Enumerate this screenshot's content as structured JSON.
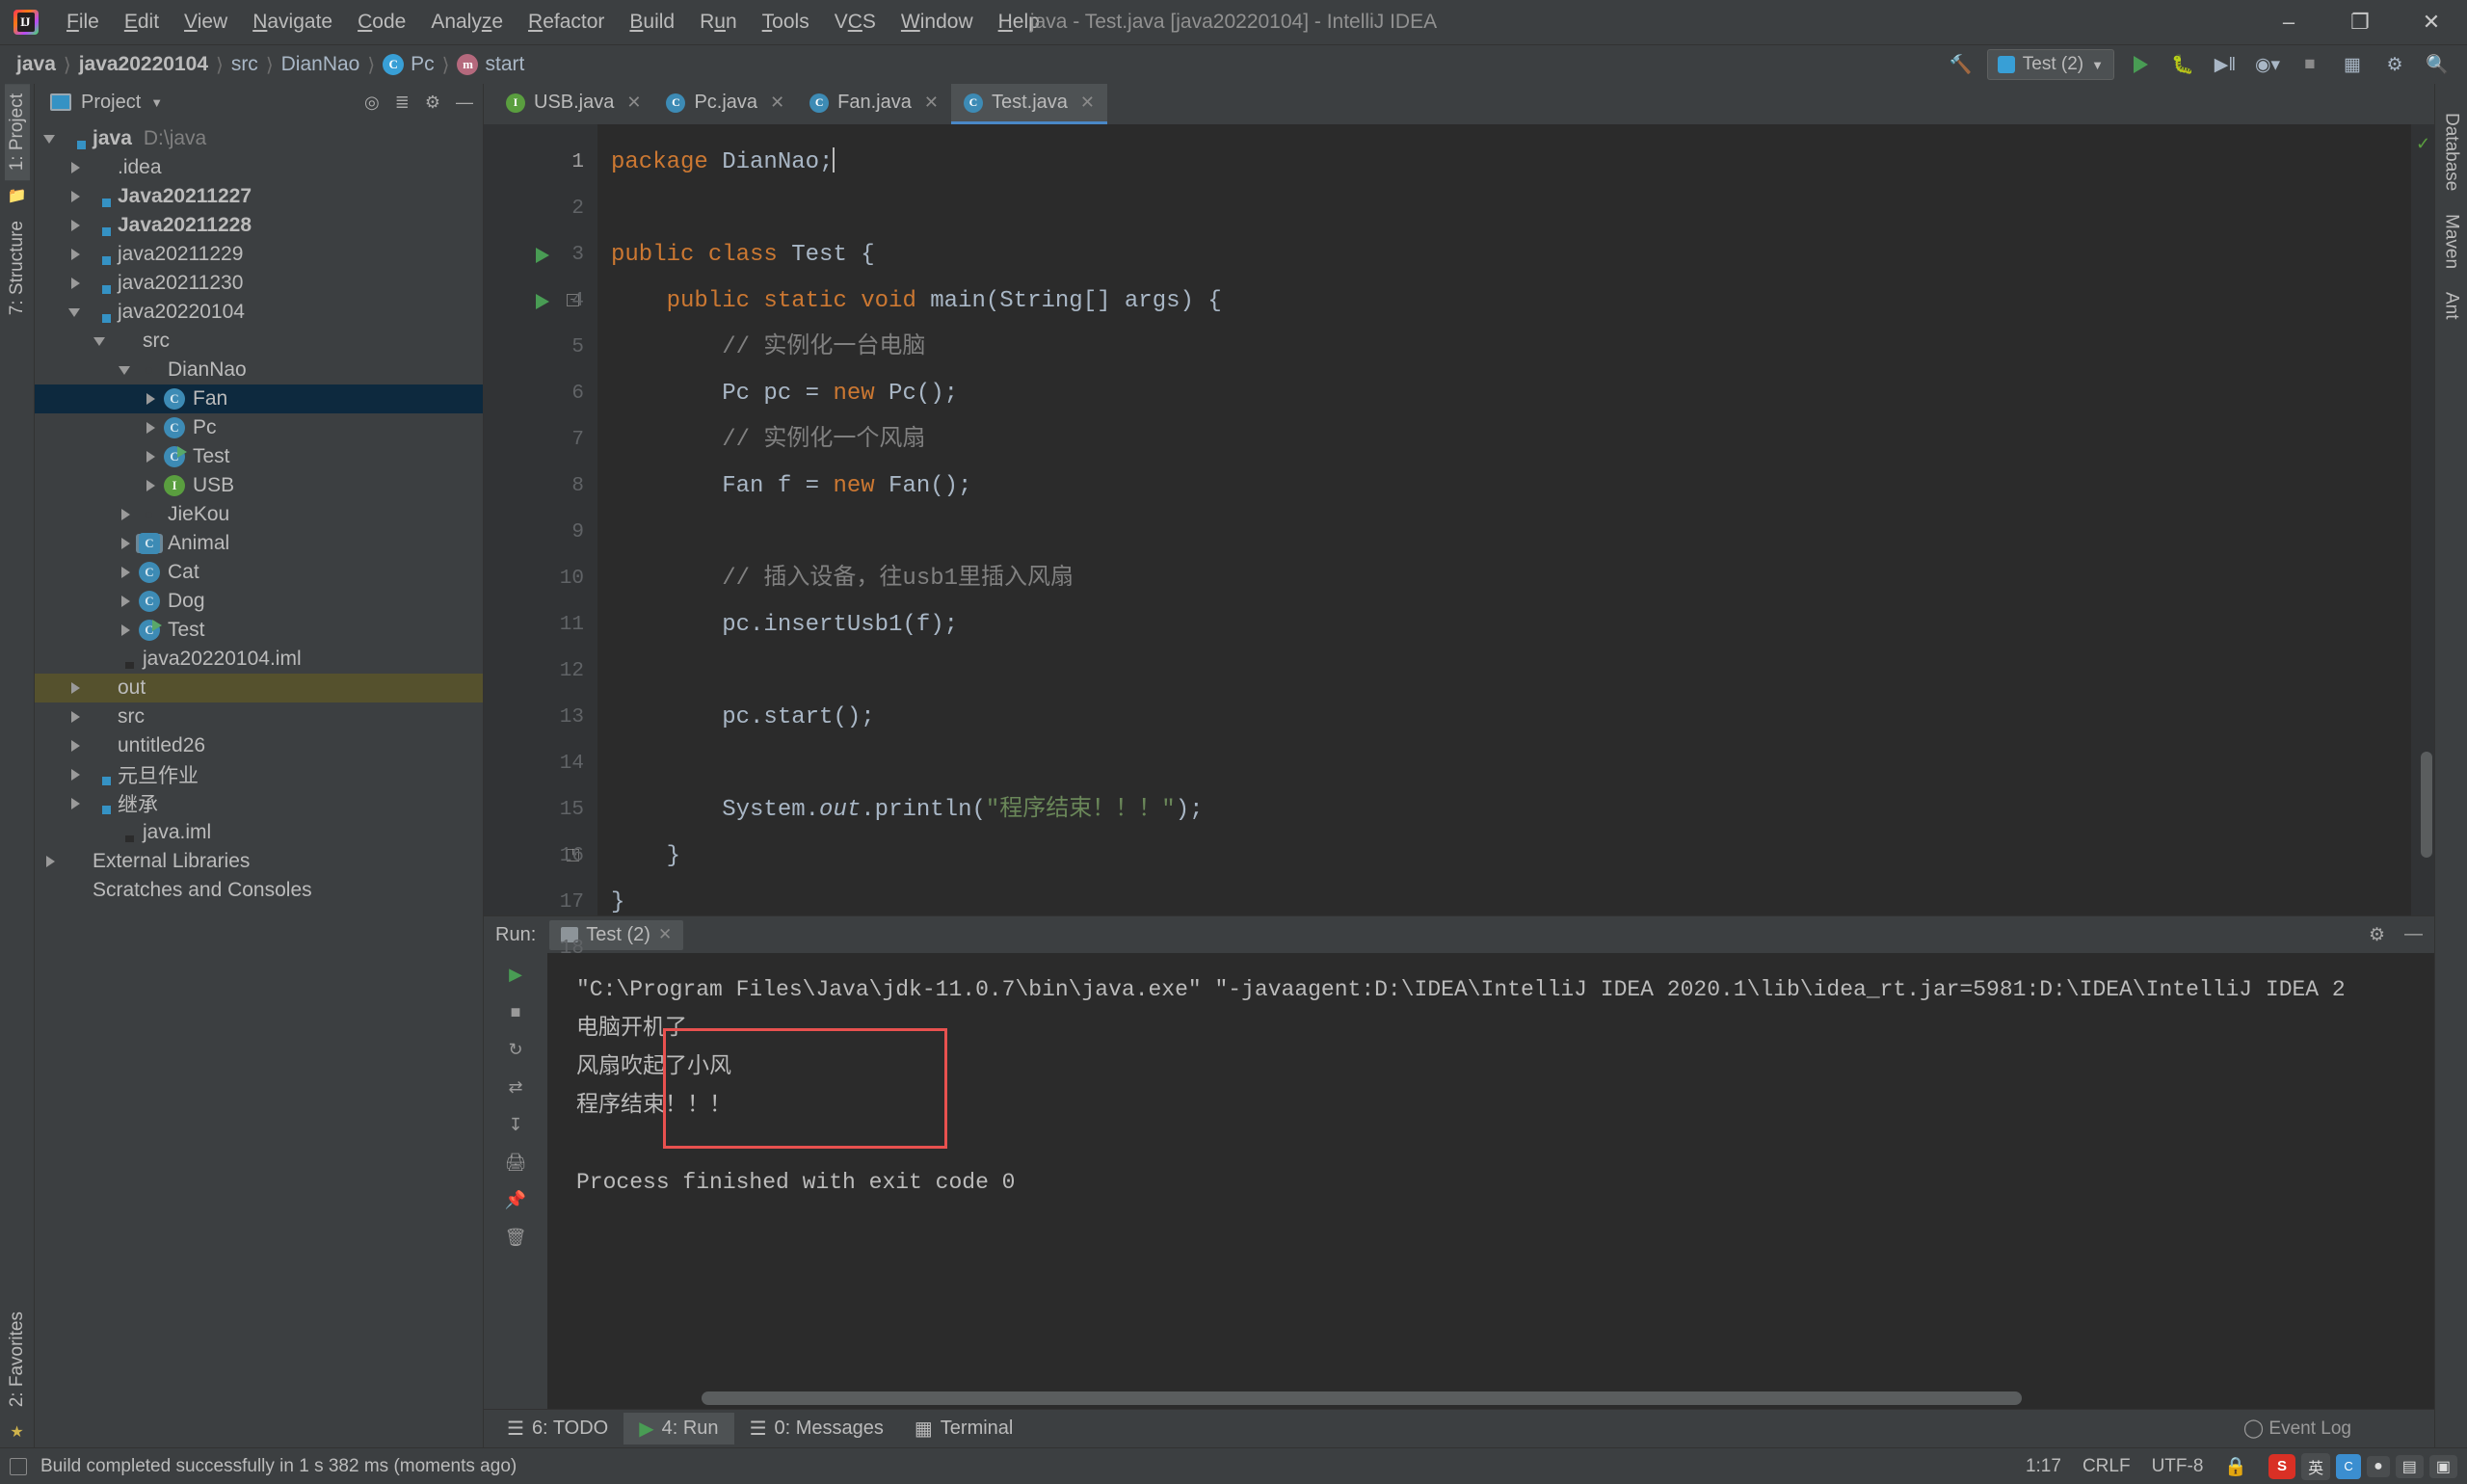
{
  "window": {
    "title": "java - Test.java [java20220104] - IntelliJ IDEA",
    "minimize": "–",
    "maximize": "❐",
    "close": "✕"
  },
  "menu": [
    {
      "label": "File"
    },
    {
      "label": "Edit"
    },
    {
      "label": "View"
    },
    {
      "label": "Navigate"
    },
    {
      "label": "Code"
    },
    {
      "label": "Analyze"
    },
    {
      "label": "Refactor"
    },
    {
      "label": "Build"
    },
    {
      "label": "Run"
    },
    {
      "label": "Tools"
    },
    {
      "label": "VCS"
    },
    {
      "label": "Window"
    },
    {
      "label": "Help"
    }
  ],
  "breadcrumb": [
    {
      "label": "java",
      "bold": true
    },
    {
      "label": "java20220104",
      "bold": true
    },
    {
      "label": "src",
      "bold": false
    },
    {
      "label": "DianNao",
      "bold": false
    },
    {
      "label": "Pc",
      "icon": "class-icon"
    },
    {
      "label": "start",
      "icon": "method-icon"
    }
  ],
  "toolbar": {
    "run_config": "Test (2)",
    "run_label": "Run",
    "debug_label": "Debug",
    "coverage_label": "Run with Coverage",
    "profile_label": "Profiler",
    "stop_label": "Stop",
    "search_label": "Search Everywhere",
    "build_label": "Build Project"
  },
  "project_panel": {
    "title": "Project",
    "settings_icon": "gear-icon",
    "collapse_icon": "collapse-all-icon",
    "locate_icon": "select-opened-file-icon",
    "hide_icon": "hide-icon",
    "tree": [
      {
        "label": "java",
        "detail": "D:\\java",
        "depth": 0,
        "arrow": "down",
        "icon": "module-folder",
        "bold": true
      },
      {
        "label": ".idea",
        "detail": "",
        "depth": 1,
        "arrow": "right",
        "icon": "plain-folder",
        "bold": false
      },
      {
        "label": "Java20211227",
        "detail": "",
        "depth": 1,
        "arrow": "right",
        "icon": "module-folder",
        "bold": true
      },
      {
        "label": "Java20211228",
        "detail": "",
        "depth": 1,
        "arrow": "right",
        "icon": "module-folder",
        "bold": true
      },
      {
        "label": "java20211229",
        "detail": "",
        "depth": 1,
        "arrow": "right",
        "icon": "module-folder",
        "bold": false
      },
      {
        "label": "java20211230",
        "detail": "",
        "depth": 1,
        "arrow": "right",
        "icon": "module-folder",
        "bold": false
      },
      {
        "label": "java20220104",
        "detail": "",
        "depth": 1,
        "arrow": "down",
        "icon": "module-folder",
        "bold": false
      },
      {
        "label": "src",
        "detail": "",
        "depth": 2,
        "arrow": "down",
        "icon": "source-folder",
        "bold": false
      },
      {
        "label": "DianNao",
        "detail": "",
        "depth": 3,
        "arrow": "down",
        "icon": "package-folder",
        "bold": false
      },
      {
        "label": "Fan",
        "detail": "",
        "depth": 4,
        "arrow": "right",
        "icon": "class-icon",
        "bold": false,
        "selected": true
      },
      {
        "label": "Pc",
        "detail": "",
        "depth": 4,
        "arrow": "right",
        "icon": "class-icon",
        "bold": false
      },
      {
        "label": "Test",
        "detail": "",
        "depth": 4,
        "arrow": "right",
        "icon": "runnable-class-icon",
        "bold": false
      },
      {
        "label": "USB",
        "detail": "",
        "depth": 4,
        "arrow": "right",
        "icon": "interface-icon",
        "bold": false
      },
      {
        "label": "JieKou",
        "detail": "",
        "depth": 3,
        "arrow": "right",
        "icon": "package-folder",
        "bold": false
      },
      {
        "label": "Animal",
        "detail": "",
        "depth": 3,
        "arrow": "right",
        "icon": "abstract-class-icon",
        "bold": false
      },
      {
        "label": "Cat",
        "detail": "",
        "depth": 3,
        "arrow": "right",
        "icon": "class-icon",
        "bold": false
      },
      {
        "label": "Dog",
        "detail": "",
        "depth": 3,
        "arrow": "right",
        "icon": "class-icon",
        "bold": false
      },
      {
        "label": "Test",
        "detail": "",
        "depth": 3,
        "arrow": "right",
        "icon": "runnable-class-icon",
        "bold": false
      },
      {
        "label": "java20220104.iml",
        "detail": "",
        "depth": 2,
        "arrow": "none",
        "icon": "iml-file-icon",
        "bold": false
      },
      {
        "label": "out",
        "detail": "",
        "depth": 1,
        "arrow": "right",
        "icon": "excluded-folder",
        "bold": false,
        "olive": true
      },
      {
        "label": "src",
        "detail": "",
        "depth": 1,
        "arrow": "right",
        "icon": "source-folder",
        "bold": false
      },
      {
        "label": "untitled26",
        "detail": "",
        "depth": 1,
        "arrow": "right",
        "icon": "plain-folder",
        "bold": false
      },
      {
        "label": "元旦作业",
        "detail": "",
        "depth": 1,
        "arrow": "right",
        "icon": "module-folder",
        "bold": false
      },
      {
        "label": "继承",
        "detail": "",
        "depth": 1,
        "arrow": "right",
        "icon": "module-folder",
        "bold": false
      },
      {
        "label": "java.iml",
        "detail": "",
        "depth": 2,
        "arrow": "none",
        "icon": "iml-file-icon",
        "bold": false
      },
      {
        "label": "External Libraries",
        "detail": "",
        "depth": 0,
        "arrow": "right",
        "icon": "library-icon",
        "bold": false
      },
      {
        "label": "Scratches and Consoles",
        "detail": "",
        "depth": 0,
        "arrow": "none",
        "icon": "scratches-icon",
        "bold": false
      }
    ]
  },
  "left_rail": [
    {
      "label": "1: Project",
      "selected": true
    },
    {
      "label": "7: Structure",
      "selected": false
    },
    {
      "label": "2: Favorites",
      "selected": false
    }
  ],
  "right_rail": [
    {
      "label": "Database"
    },
    {
      "label": "Maven"
    },
    {
      "label": "Ant"
    }
  ],
  "editor": {
    "tabs": [
      {
        "label": "USB.java",
        "icon": "interface-icon",
        "active": false
      },
      {
        "label": "Pc.java",
        "icon": "class-icon",
        "active": false
      },
      {
        "label": "Fan.java",
        "icon": "class-icon",
        "active": false
      },
      {
        "label": "Test.java",
        "icon": "class-icon",
        "active": true
      }
    ],
    "close_glyph": "✕",
    "line_numbers": [
      "1",
      "2",
      "3",
      "4",
      "5",
      "6",
      "7",
      "8",
      "9",
      "10",
      "11",
      "12",
      "13",
      "14",
      "15",
      "16",
      "17",
      "18"
    ],
    "current_line": 1,
    "inspection_status": "✓",
    "lines": [
      {
        "n": 1,
        "tokens": [
          {
            "t": "package ",
            "c": "kw"
          },
          {
            "t": "DianNao;",
            "c": "cls2"
          }
        ],
        "caret": true
      },
      {
        "n": 2,
        "tokens": []
      },
      {
        "n": 3,
        "tokens": [
          {
            "t": "public class ",
            "c": "kw"
          },
          {
            "t": "Test {",
            "c": "cls2"
          }
        ],
        "gutter_run": true
      },
      {
        "n": 4,
        "tokens": [
          {
            "t": "    ",
            "c": "cls2"
          },
          {
            "t": "public static void ",
            "c": "kw"
          },
          {
            "t": "main(String[] args) {",
            "c": "cls2"
          }
        ],
        "gutter_run": true,
        "fold": true
      },
      {
        "n": 5,
        "tokens": [
          {
            "t": "        // 实例化一台电脑",
            "c": "cmt"
          }
        ]
      },
      {
        "n": 6,
        "tokens": [
          {
            "t": "        Pc pc = ",
            "c": "cls2"
          },
          {
            "t": "new ",
            "c": "kw"
          },
          {
            "t": "Pc();",
            "c": "cls2"
          }
        ]
      },
      {
        "n": 7,
        "tokens": [
          {
            "t": "        // 实例化一个风扇",
            "c": "cmt"
          }
        ]
      },
      {
        "n": 8,
        "tokens": [
          {
            "t": "        Fan f = ",
            "c": "cls2"
          },
          {
            "t": "new ",
            "c": "kw"
          },
          {
            "t": "Fan();",
            "c": "cls2"
          }
        ]
      },
      {
        "n": 9,
        "tokens": []
      },
      {
        "n": 10,
        "tokens": [
          {
            "t": "        // 插入设备，往usb1里插入风扇",
            "c": "cmt"
          }
        ]
      },
      {
        "n": 11,
        "tokens": [
          {
            "t": "        pc.insertUsb1(f);",
            "c": "cls2"
          }
        ]
      },
      {
        "n": 12,
        "tokens": []
      },
      {
        "n": 13,
        "tokens": [
          {
            "t": "        pc.start();",
            "c": "cls2"
          }
        ]
      },
      {
        "n": 14,
        "tokens": []
      },
      {
        "n": 15,
        "tokens": [
          {
            "t": "        System.",
            "c": "cls2"
          },
          {
            "t": "out",
            "c": "ital"
          },
          {
            "t": ".println(",
            "c": "cls2"
          },
          {
            "t": "\"程序结束！！！\"",
            "c": "str"
          },
          {
            "t": ");",
            "c": "cls2"
          }
        ]
      },
      {
        "n": 16,
        "tokens": [
          {
            "t": "    }",
            "c": "cls2"
          }
        ],
        "fold_end": true
      },
      {
        "n": 17,
        "tokens": [
          {
            "t": "}",
            "c": "cls2"
          }
        ]
      },
      {
        "n": 18,
        "tokens": []
      }
    ]
  },
  "run_panel": {
    "label": "Run:",
    "tab_label": "Test (2)",
    "close_glyph": "✕",
    "settings_icon": "gear-icon",
    "minimize_icon": "minimize-icon",
    "side_buttons": [
      "rerun-icon",
      "stop-icon",
      "resume-icon",
      "step-icon",
      "layout-icon",
      "print-icon",
      "pin-icon",
      "trash-icon"
    ],
    "console_lines": [
      "\"C:\\Program Files\\Java\\jdk-11.0.7\\bin\\java.exe\" \"-javaagent:D:\\IDEA\\IntelliJ IDEA 2020.1\\lib\\idea_rt.jar=5981:D:\\IDEA\\IntelliJ IDEA 2",
      "电脑开机了",
      "风扇吹起了小风",
      "程序结束！！！",
      "",
      "Process finished with exit code 0"
    ],
    "highlight_color": "#e8514f"
  },
  "tool_windows": [
    {
      "label": "6: TODO",
      "icon": "todo-icon",
      "selected": false
    },
    {
      "label": "4: Run",
      "icon": "run-icon",
      "selected": true
    },
    {
      "label": "0: Messages",
      "icon": "messages-icon",
      "selected": false
    },
    {
      "label": "Terminal",
      "icon": "terminal-icon",
      "selected": false
    }
  ],
  "status_bar": {
    "message": "Build completed successfully in 1 s 382 ms (moments ago)",
    "caret_position": "1:17",
    "line_separator": "CRLF",
    "encoding": "UTF-8",
    "event_log": "Event Log",
    "tray": [
      "sogou-ime",
      "csdn",
      "ime-zh",
      "ime-tools"
    ],
    "ime_label": "英"
  }
}
